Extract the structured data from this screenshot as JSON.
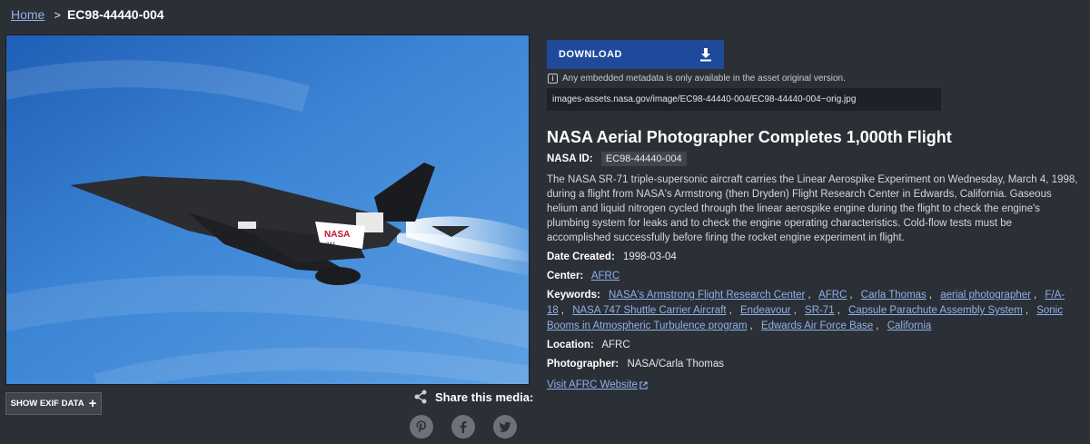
{
  "breadcrumb": {
    "home": "Home",
    "separator": ">",
    "current": "EC98-44440-004"
  },
  "photo": {
    "tail_text": "NASA",
    "tail_number": "844"
  },
  "exif": {
    "label": "SHOW EXIF DATA",
    "icon": "plus-icon"
  },
  "share": {
    "label": "Share this media:",
    "networks": [
      "pinterest",
      "facebook",
      "twitter"
    ]
  },
  "download": {
    "label": "DOWNLOAD",
    "icon": "download-icon"
  },
  "metadata_note": "Any embedded metadata is only available in the asset original version.",
  "asset_url": "images-assets.nasa.gov/image/EC98-44440-004/EC98-44440-004~orig.jpg",
  "details": {
    "title": "NASA Aerial Photographer Completes 1,000th Flight",
    "nasa_id_label": "NASA ID:",
    "nasa_id": "EC98-44440-004",
    "description": "The NASA SR-71 triple-supersonic aircraft carries the Linear Aerospike Experiment on Wednesday, March 4, 1998, during a flight from NASA's Armstrong (then Dryden) Flight Research Center in Edwards, California. Gaseous helium and liquid nitrogen cycled through the linear aerospike engine during the flight to check the engine's plumbing system for leaks and to check the engine operating characteristics. Cold-flow tests must be accomplished successfully before firing the rocket engine experiment in flight.",
    "date_label": "Date Created:",
    "date": "1998-03-04",
    "center_label": "Center:",
    "center": "AFRC",
    "keywords_label": "Keywords:",
    "keywords": [
      "NASA's Armstrong Flight Research Center",
      "AFRC",
      "Carla Thomas",
      "aerial photographer",
      "F/A-18",
      "NASA 747 Shuttle Carrier Aircraft",
      "Endeavour",
      "SR-71",
      "Capsule Parachute Assembly System",
      "Sonic Booms in Atmospheric Turbulence program",
      "Edwards Air Force Base",
      "California"
    ],
    "keyword_separator": ",",
    "location_label": "Location:",
    "location": "AFRC",
    "photographer_label": "Photographer:",
    "photographer": "NASA/Carla Thomas",
    "visit_link": "Visit AFRC Website"
  },
  "colors": {
    "background": "#2b2f36",
    "accent": "#1f4a9b",
    "link": "#8fb1e8"
  }
}
